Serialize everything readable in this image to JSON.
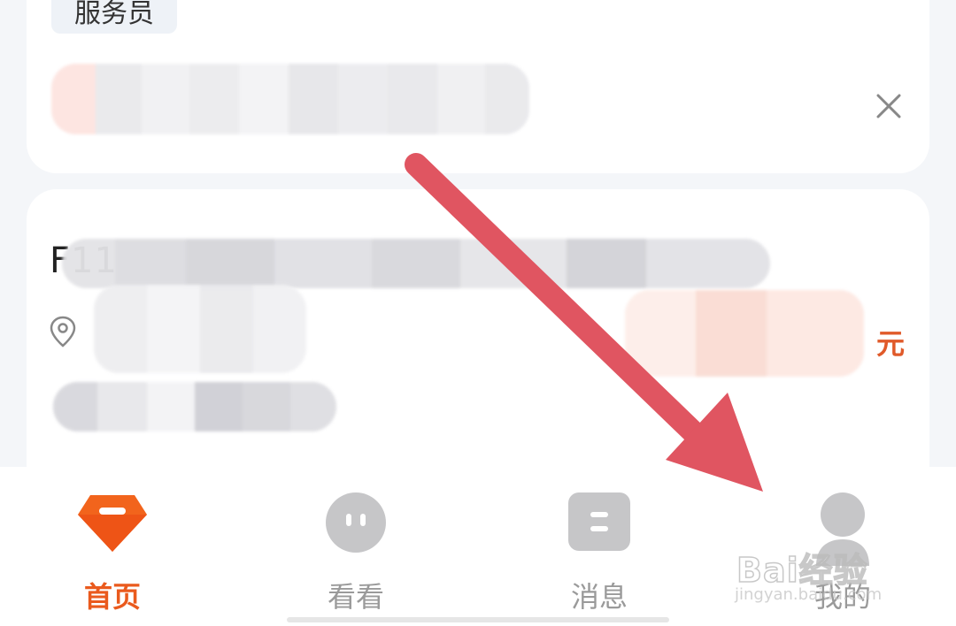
{
  "card_top": {
    "tag_label": "服务员",
    "close_icon": "close-icon"
  },
  "card_job": {
    "title": "F11",
    "price_unit": "元",
    "location_icon": "location-pin-icon"
  },
  "tabbar": {
    "tabs": [
      {
        "label": "首页",
        "icon": "diamond-home-icon",
        "active": true
      },
      {
        "label": "看看",
        "icon": "face-icon",
        "active": false
      },
      {
        "label": "消息",
        "icon": "message-icon",
        "active": false
      },
      {
        "label": "我的",
        "icon": "profile-icon",
        "active": false
      }
    ]
  },
  "watermark": {
    "brand": "Bai经验",
    "url": "jingyan.baidu.com"
  },
  "colors": {
    "accent": "#ea5a1d",
    "arrow": "#e05561",
    "inactive": "#9a9a9a"
  }
}
